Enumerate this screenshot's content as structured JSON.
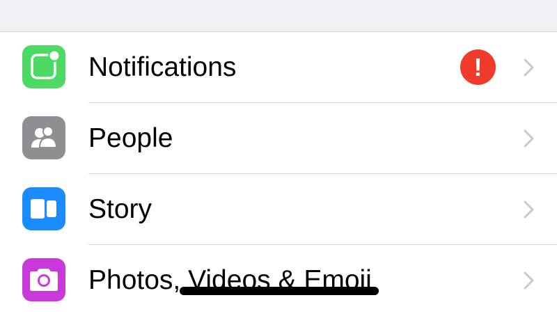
{
  "settings": {
    "items": [
      {
        "label": "Notifications",
        "icon": "notifications-icon",
        "icon_color": "#4cd964",
        "badge": "!",
        "badge_color": "#f03a2b"
      },
      {
        "label": "People",
        "icon": "people-icon",
        "icon_color": "#8e8e93"
      },
      {
        "label": "Story",
        "icon": "story-icon",
        "icon_color": "#1a8cff"
      },
      {
        "label": "Photos, Videos & Emoji",
        "icon": "camera-icon",
        "icon_color": "#c83ad8"
      }
    ]
  },
  "colors": {
    "background": "#ffffff",
    "top_band": "#efeff4",
    "separator": "#d6d6da",
    "chevron": "#c7c7cc"
  }
}
